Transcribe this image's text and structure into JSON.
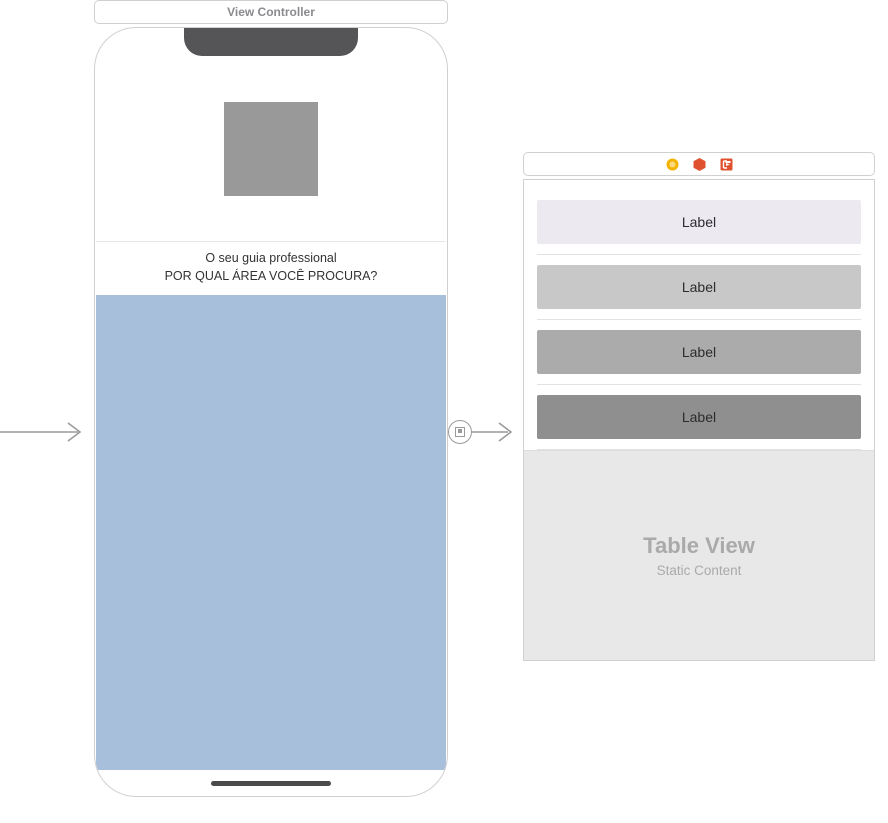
{
  "left_scene": {
    "title": "View Controller",
    "guide_line1": "O seu guia professional",
    "guide_line2": "POR QUAL ÁREA VOCÊ PROCURA?"
  },
  "right_scene": {
    "cells": [
      {
        "label": "Label"
      },
      {
        "label": "Label"
      },
      {
        "label": "Label"
      },
      {
        "label": "Label"
      }
    ],
    "footer_title": "Table View",
    "footer_subtitle": "Static Content"
  },
  "icons": {
    "vc": "◉",
    "first": "◉",
    "exit": "◉"
  }
}
